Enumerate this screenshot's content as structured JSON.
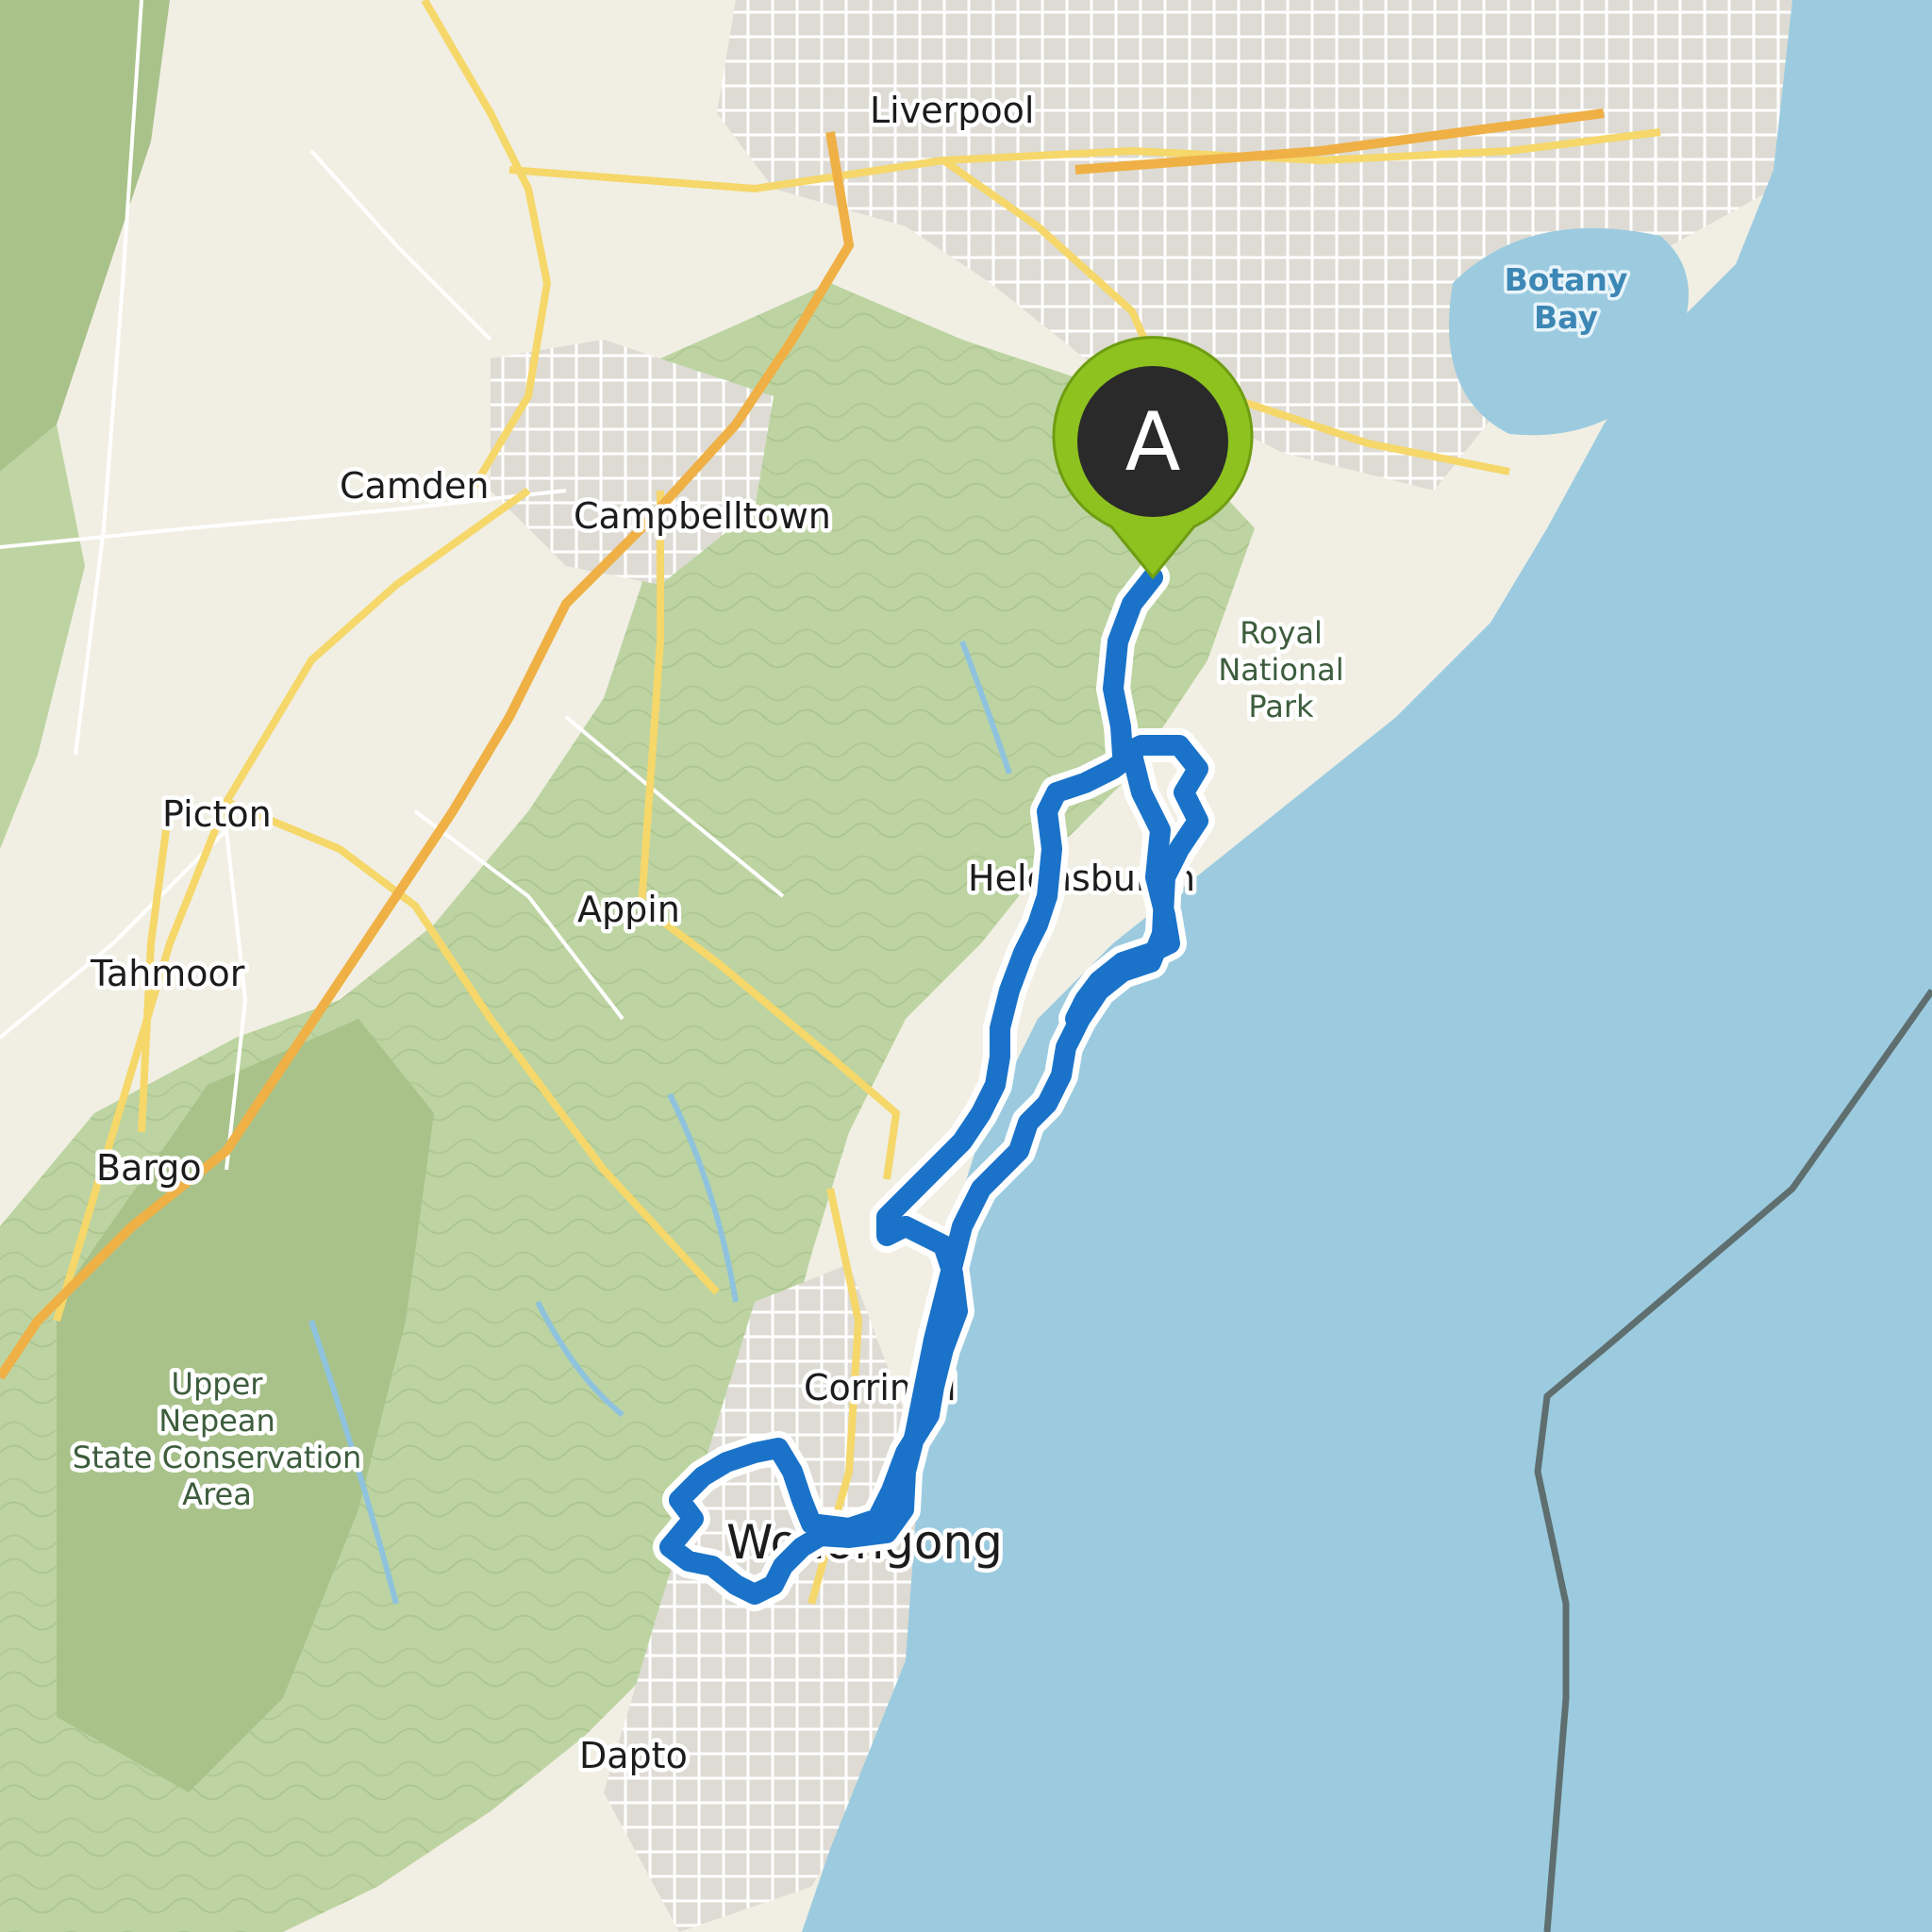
{
  "map": {
    "places": [
      {
        "name": "Liverpool"
      },
      {
        "name": "Camden"
      },
      {
        "name": "Campbelltown"
      },
      {
        "name": "Picton"
      },
      {
        "name": "Appin"
      },
      {
        "name": "Tahmoor"
      },
      {
        "name": "Bargo"
      },
      {
        "name": "Helensburgh"
      },
      {
        "name": "Corrimal"
      },
      {
        "name": "Wollongong"
      },
      {
        "name": "Dapto"
      }
    ],
    "parks": {
      "royal": [
        "Royal",
        "National",
        "Park"
      ],
      "nepean": [
        "Upper",
        "Nepean",
        "State Conservation",
        "Area"
      ]
    },
    "water": {
      "botany": [
        "Botany",
        "Bay"
      ]
    },
    "route": {
      "color": "#1a73c9",
      "casing_color": "#ffffff",
      "start_marker": {
        "label": "A",
        "color": "#8dc21f",
        "inner_color": "#2a2a2a"
      }
    },
    "colors": {
      "ocean": "#9ccbe0",
      "park": "#bdd4a2",
      "forest": "#a8c28a",
      "urban": "#dcdad2",
      "road_major": "#f5d76a",
      "road_motorway": "#efb045",
      "road_minor": "#ffffff",
      "boundary": "#5f6e6e"
    }
  }
}
